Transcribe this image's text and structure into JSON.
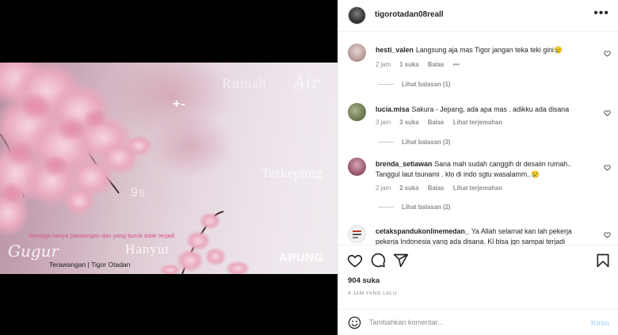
{
  "post": {
    "username": "tigorotadan08reall",
    "more_icon": "more-horizontal-icon",
    "image_overlay": {
      "rumah": "Rumah",
      "air": "Air",
      "plus_minus": "+-",
      "terkepung": "Terkepung",
      "nine_s": "9s",
      "semoga": "Semoga hanya pandangan dan yang buruk tidak terjadi",
      "hanyut": "Hanyut",
      "gugur": "Gugur",
      "terawangan": "Terawangan | Tigor Otadan",
      "apung": "APUNG"
    }
  },
  "comments": [
    {
      "username": "hesti_valen",
      "text": "Langsung aja mas Tigor jangan teka teki gini😢",
      "time": "2 jam",
      "likes": "1 suka",
      "reply": "Balas",
      "extra": "•••",
      "view_replies": "Lihat balasan (1)",
      "avatar_color": "#c9b4b4"
    },
    {
      "username": "lucia.misa",
      "text": "Sakura - Jepang, ada apa mas . adikku ada disana",
      "time": "3 jam",
      "likes": "3 suka",
      "reply": "Balas",
      "extra": "Lihat terjemahan",
      "view_replies": "Lihat balasan (3)",
      "avatar_color": "#7f8a64"
    },
    {
      "username": "brenda_setiawan",
      "text": "Sana mah sudah canggih dr desaiin rumah.. Tanggul laut tsunami . klo di indo sgtu wasalamm..😢",
      "time": "2 jam",
      "likes": "2 suka",
      "reply": "Balas",
      "extra": "Lihat terjemahan",
      "view_replies": "Lihat balasan (2)",
      "avatar_color": "#9c5a6e"
    },
    {
      "username": "cetakspandukonlinemedan_",
      "text": "Ya Allah selamat kan lah pekerja pekerja Indonesia yang ada disana. Kl bisa jgn sampai terjadi",
      "time": "",
      "likes": "",
      "reply": "",
      "extra": "",
      "view_replies": "",
      "avatar_color": "#e6e6e6"
    }
  ],
  "actions": {
    "like_icon": "heart-icon",
    "comment_icon": "comment-icon",
    "share_icon": "share-icon",
    "save_icon": "bookmark-icon"
  },
  "likes": "904 suka",
  "time_ago": "4 JAM YANG LALU",
  "add_comment": {
    "placeholder": "Tambahkan komentar...",
    "value": "",
    "post_label": "Kirim",
    "emoji_icon": "emoji-icon",
    "post_color": "#b3dbff"
  }
}
